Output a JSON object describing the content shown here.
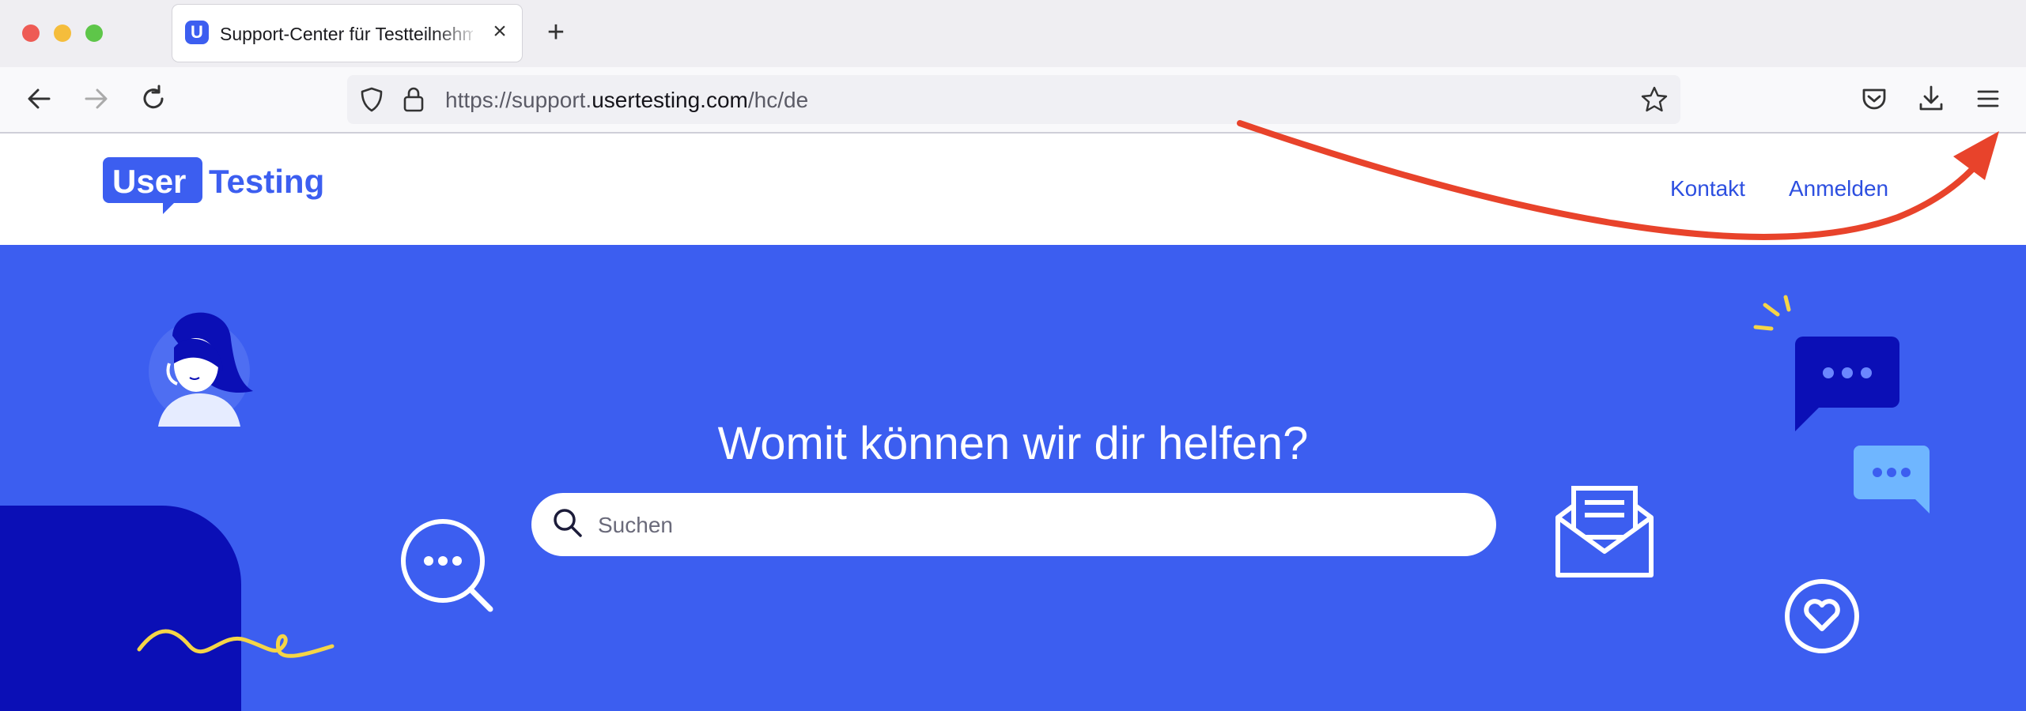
{
  "browser": {
    "tab": {
      "favicon": "U",
      "title": "Support-Center für Testteilnehmer",
      "close_label": "×"
    },
    "new_tab_label": "+",
    "url": {
      "prefix": "https://support.",
      "host": "usertesting.com",
      "path": "/hc/de"
    },
    "icons": [
      "back-icon",
      "forward-icon",
      "reload-icon",
      "shield-icon",
      "lock-icon",
      "bookmark-star-icon",
      "pocket-icon",
      "download-icon",
      "menu-icon"
    ]
  },
  "site": {
    "logo": {
      "part1": "User",
      "part2": "Testing"
    },
    "nav": {
      "contact": "Kontakt",
      "login": "Anmelden"
    },
    "hero": {
      "title": "Womit können wir dir helfen?",
      "search_placeholder": "Suchen"
    }
  },
  "colors": {
    "brand_blue": "#3c5ef0",
    "dark_blue": "#0b0fb6",
    "accent_yellow": "#f5d547",
    "annotation_red": "#e8432b"
  }
}
